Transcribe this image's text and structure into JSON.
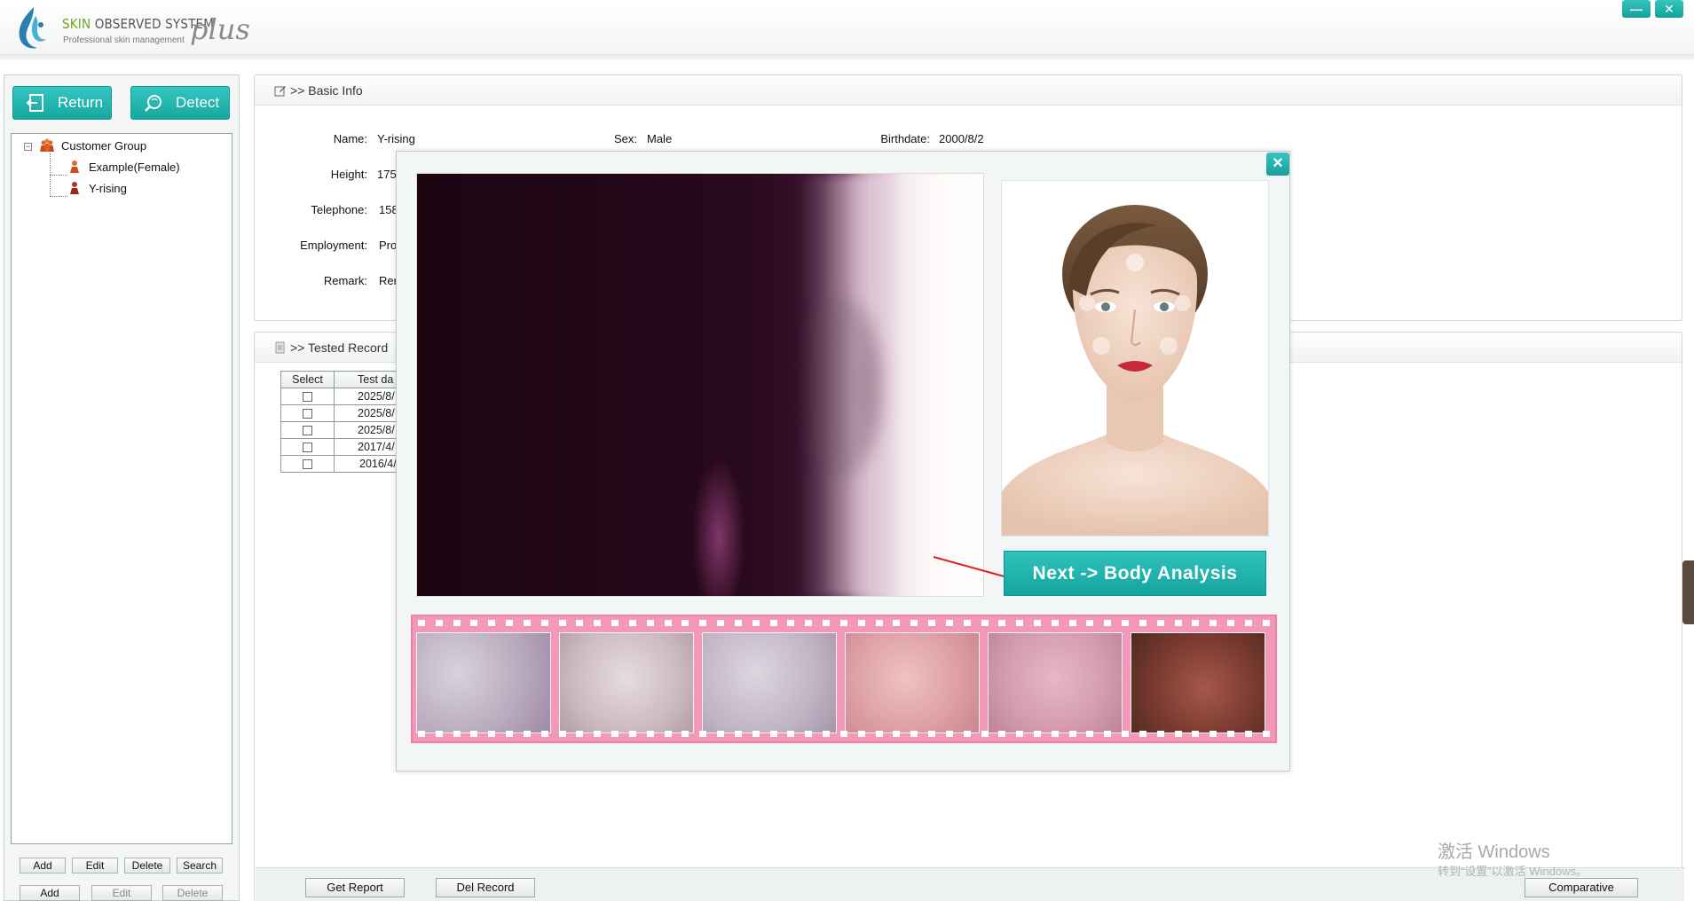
{
  "app": {
    "brand_skin": "SKIN",
    "brand_rest": " OBSERVED SYSTEM",
    "brand_sub": "Professional skin management",
    "brand_plus": "plus",
    "min_label": "—",
    "close_label": "✕"
  },
  "toolbar": {
    "return_label": "Return",
    "detect_label": "Detect"
  },
  "tree": {
    "root": "Customer Group",
    "children": [
      "Example(Female)",
      "Y-rising"
    ]
  },
  "left_actions": {
    "row1": [
      "Add",
      "Edit",
      "Delete",
      "Search"
    ],
    "row2": [
      "Add",
      "Edit",
      "Delete"
    ]
  },
  "basic_info": {
    "title": ">> Basic Info",
    "name_label": "Name:",
    "name": "Y-rising",
    "sex_label": "Sex:",
    "sex": "Male",
    "birthdate_label": "Birthdate:",
    "birthdate": "2000/8/2",
    "height_label": "Height:",
    "height": "175",
    "telephone_label": "Telephone:",
    "telephone": "158",
    "employment_label": "Employment:",
    "employment": "Pro",
    "remark_label": "Remark:",
    "remark": "Rer"
  },
  "tested_record": {
    "title": ">> Tested Record",
    "headers": [
      "Select",
      "Test da"
    ],
    "rows": [
      "2025/8/",
      "2025/8/",
      "2025/8/",
      "2017/4/",
      "2016/4/"
    ]
  },
  "bottom": {
    "get_report": "Get Report",
    "del_record": "Del Record",
    "comparative": "Comparative"
  },
  "watermark": {
    "line1": "激活 Windows",
    "line2": "转到“设置”以激活 Windows。"
  },
  "dialog": {
    "close_label": "×",
    "next_label": "Next -> Body Analysis",
    "accent": "#1aaca6"
  }
}
